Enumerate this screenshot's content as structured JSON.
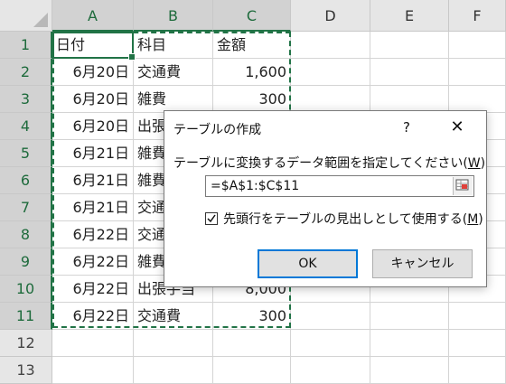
{
  "sheet": {
    "columns": [
      "A",
      "B",
      "C",
      "D",
      "E",
      "F"
    ],
    "rows": [
      "1",
      "2",
      "3",
      "4",
      "5",
      "6",
      "7",
      "8",
      "9",
      "10",
      "11",
      "12",
      "13"
    ],
    "cells": [
      [
        "日付",
        "科目",
        "金額"
      ],
      [
        "6月20日",
        "交通費",
        "1,600"
      ],
      [
        "6月20日",
        "雑費",
        "300"
      ],
      [
        "6月20日",
        "出張",
        ""
      ],
      [
        "6月21日",
        "雑費",
        ""
      ],
      [
        "6月21日",
        "雑費",
        ""
      ],
      [
        "6月21日",
        "交通",
        ""
      ],
      [
        "6月22日",
        "交通",
        ""
      ],
      [
        "6月22日",
        "雑費",
        ""
      ],
      [
        "6月22日",
        "出張手当",
        "8,000"
      ],
      [
        "6月22日",
        "交通費",
        "300"
      ]
    ]
  },
  "dialog": {
    "title": "テーブルの作成",
    "help": "?",
    "close": "✕",
    "prompt": "テーブルに変換するデータ範囲を指定してください(",
    "prompt_key": "W",
    "prompt_end": ")",
    "range_value": "=$A$1:$C$11",
    "checkbox_checked": true,
    "checkbox_label": "先頭行をテーブルの見出しとして使用する(",
    "checkbox_key": "M",
    "checkbox_end": ")",
    "ok_label": "OK",
    "cancel_label": "キャンセル"
  },
  "colors": {
    "accent": "#217346",
    "ok_border": "#0078d7"
  }
}
